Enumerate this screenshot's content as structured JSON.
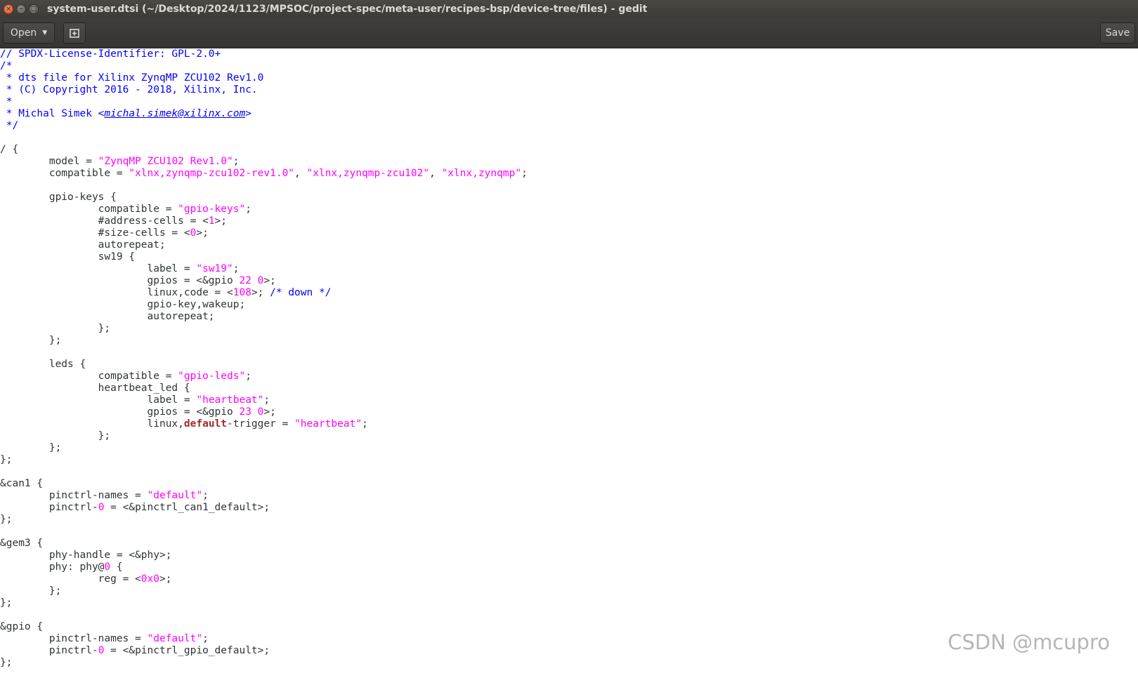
{
  "window": {
    "title": "system-user.dtsi (~/Desktop/2024/1123/MPSOC/project-spec/meta-user/recipes-bsp/device-tree/files) - gedit",
    "close_glyph": "×",
    "minimize_glyph": "–",
    "maximize_glyph": "□"
  },
  "toolbar": {
    "open_label": "Open",
    "open_caret": "▼",
    "new_tab_icon": "⊞",
    "save_label": "Save"
  },
  "editor": {
    "lines": [
      [
        {
          "t": "// SPDX-License-Identifier: GPL-2.0+",
          "c": "comment"
        }
      ],
      [
        {
          "t": "/*",
          "c": "comment"
        }
      ],
      [
        {
          "t": " * dts file for Xilinx ZynqMP ZCU102 Rev1.0",
          "c": "comment"
        }
      ],
      [
        {
          "t": " * (C) Copyright 2016 - 2018, Xilinx, Inc.",
          "c": "comment"
        }
      ],
      [
        {
          "t": " *",
          "c": "comment"
        }
      ],
      [
        {
          "t": " * Michal Simek <",
          "c": "comment"
        },
        {
          "t": "michal.simek@xilinx.com",
          "c": "link"
        },
        {
          "t": ">",
          "c": "comment"
        }
      ],
      [
        {
          "t": " */",
          "c": "comment"
        }
      ],
      [],
      [
        {
          "t": "/ {"
        }
      ],
      [
        {
          "t": "\tmodel = "
        },
        {
          "t": "\"ZynqMP ZCU102 Rev1.0\"",
          "c": "string"
        },
        {
          "t": ";"
        }
      ],
      [
        {
          "t": "\tcompatible = "
        },
        {
          "t": "\"xlnx,zynqmp-zcu102-rev1.0\"",
          "c": "string"
        },
        {
          "t": ", "
        },
        {
          "t": "\"xlnx,zynqmp-zcu102\"",
          "c": "string"
        },
        {
          "t": ", "
        },
        {
          "t": "\"xlnx,zynqmp\"",
          "c": "string"
        },
        {
          "t": ";"
        }
      ],
      [],
      [
        {
          "t": "\tgpio-keys {"
        }
      ],
      [
        {
          "t": "\t\tcompatible = "
        },
        {
          "t": "\"gpio-keys\"",
          "c": "string"
        },
        {
          "t": ";"
        }
      ],
      [
        {
          "t": "\t\t#address-cells = <"
        },
        {
          "t": "1",
          "c": "number"
        },
        {
          "t": ">;"
        }
      ],
      [
        {
          "t": "\t\t#size-cells = <"
        },
        {
          "t": "0",
          "c": "number"
        },
        {
          "t": ">;"
        }
      ],
      [
        {
          "t": "\t\tautorepeat;"
        }
      ],
      [
        {
          "t": "\t\tsw19 {"
        }
      ],
      [
        {
          "t": "\t\t\tlabel = "
        },
        {
          "t": "\"sw19\"",
          "c": "string"
        },
        {
          "t": ";"
        }
      ],
      [
        {
          "t": "\t\t\tgpios = <&gpio "
        },
        {
          "t": "22",
          "c": "number"
        },
        {
          "t": " "
        },
        {
          "t": "0",
          "c": "number"
        },
        {
          "t": ">;"
        }
      ],
      [
        {
          "t": "\t\t\tlinux,code = <"
        },
        {
          "t": "108",
          "c": "number"
        },
        {
          "t": ">; "
        },
        {
          "t": "/* down */",
          "c": "comment"
        }
      ],
      [
        {
          "t": "\t\t\tgpio-key,wakeup;"
        }
      ],
      [
        {
          "t": "\t\t\tautorepeat;"
        }
      ],
      [
        {
          "t": "\t\t};"
        }
      ],
      [
        {
          "t": "\t};"
        }
      ],
      [],
      [
        {
          "t": "\tleds {"
        }
      ],
      [
        {
          "t": "\t\tcompatible = "
        },
        {
          "t": "\"gpio-leds\"",
          "c": "string"
        },
        {
          "t": ";"
        }
      ],
      [
        {
          "t": "\t\theartbeat_led {"
        }
      ],
      [
        {
          "t": "\t\t\tlabel = "
        },
        {
          "t": "\"heartbeat\"",
          "c": "string"
        },
        {
          "t": ";"
        }
      ],
      [
        {
          "t": "\t\t\tgpios = <&gpio "
        },
        {
          "t": "23",
          "c": "number"
        },
        {
          "t": " "
        },
        {
          "t": "0",
          "c": "number"
        },
        {
          "t": ">;"
        }
      ],
      [
        {
          "t": "\t\t\tlinux,"
        },
        {
          "t": "default",
          "c": "keyword"
        },
        {
          "t": "-trigger = "
        },
        {
          "t": "\"heartbeat\"",
          "c": "string"
        },
        {
          "t": ";"
        }
      ],
      [
        {
          "t": "\t\t};"
        }
      ],
      [
        {
          "t": "\t};"
        }
      ],
      [
        {
          "t": "};"
        }
      ],
      [],
      [
        {
          "t": "&can1 {"
        }
      ],
      [
        {
          "t": "\tpinctrl-names = "
        },
        {
          "t": "\"default\"",
          "c": "string"
        },
        {
          "t": ";"
        }
      ],
      [
        {
          "t": "\tpinctrl-"
        },
        {
          "t": "0",
          "c": "number"
        },
        {
          "t": " = <&pinctrl_can1_default>;"
        }
      ],
      [
        {
          "t": "};"
        }
      ],
      [],
      [
        {
          "t": "&gem3 {"
        }
      ],
      [
        {
          "t": "\tphy-handle = <&phy>;"
        }
      ],
      [
        {
          "t": "\tphy: phy@"
        },
        {
          "t": "0",
          "c": "number"
        },
        {
          "t": " {"
        }
      ],
      [
        {
          "t": "\t\treg = <"
        },
        {
          "t": "0x0",
          "c": "number"
        },
        {
          "t": ">;"
        }
      ],
      [
        {
          "t": "\t};"
        }
      ],
      [
        {
          "t": "};"
        }
      ],
      [],
      [
        {
          "t": "&gpio {"
        }
      ],
      [
        {
          "t": "\tpinctrl-names = "
        },
        {
          "t": "\"default\"",
          "c": "string"
        },
        {
          "t": ";"
        }
      ],
      [
        {
          "t": "\tpinctrl-"
        },
        {
          "t": "0",
          "c": "number"
        },
        {
          "t": " = <&pinctrl_gpio_default>;"
        }
      ],
      [
        {
          "t": "};"
        }
      ]
    ]
  },
  "watermark": "CSDN @mcupro"
}
